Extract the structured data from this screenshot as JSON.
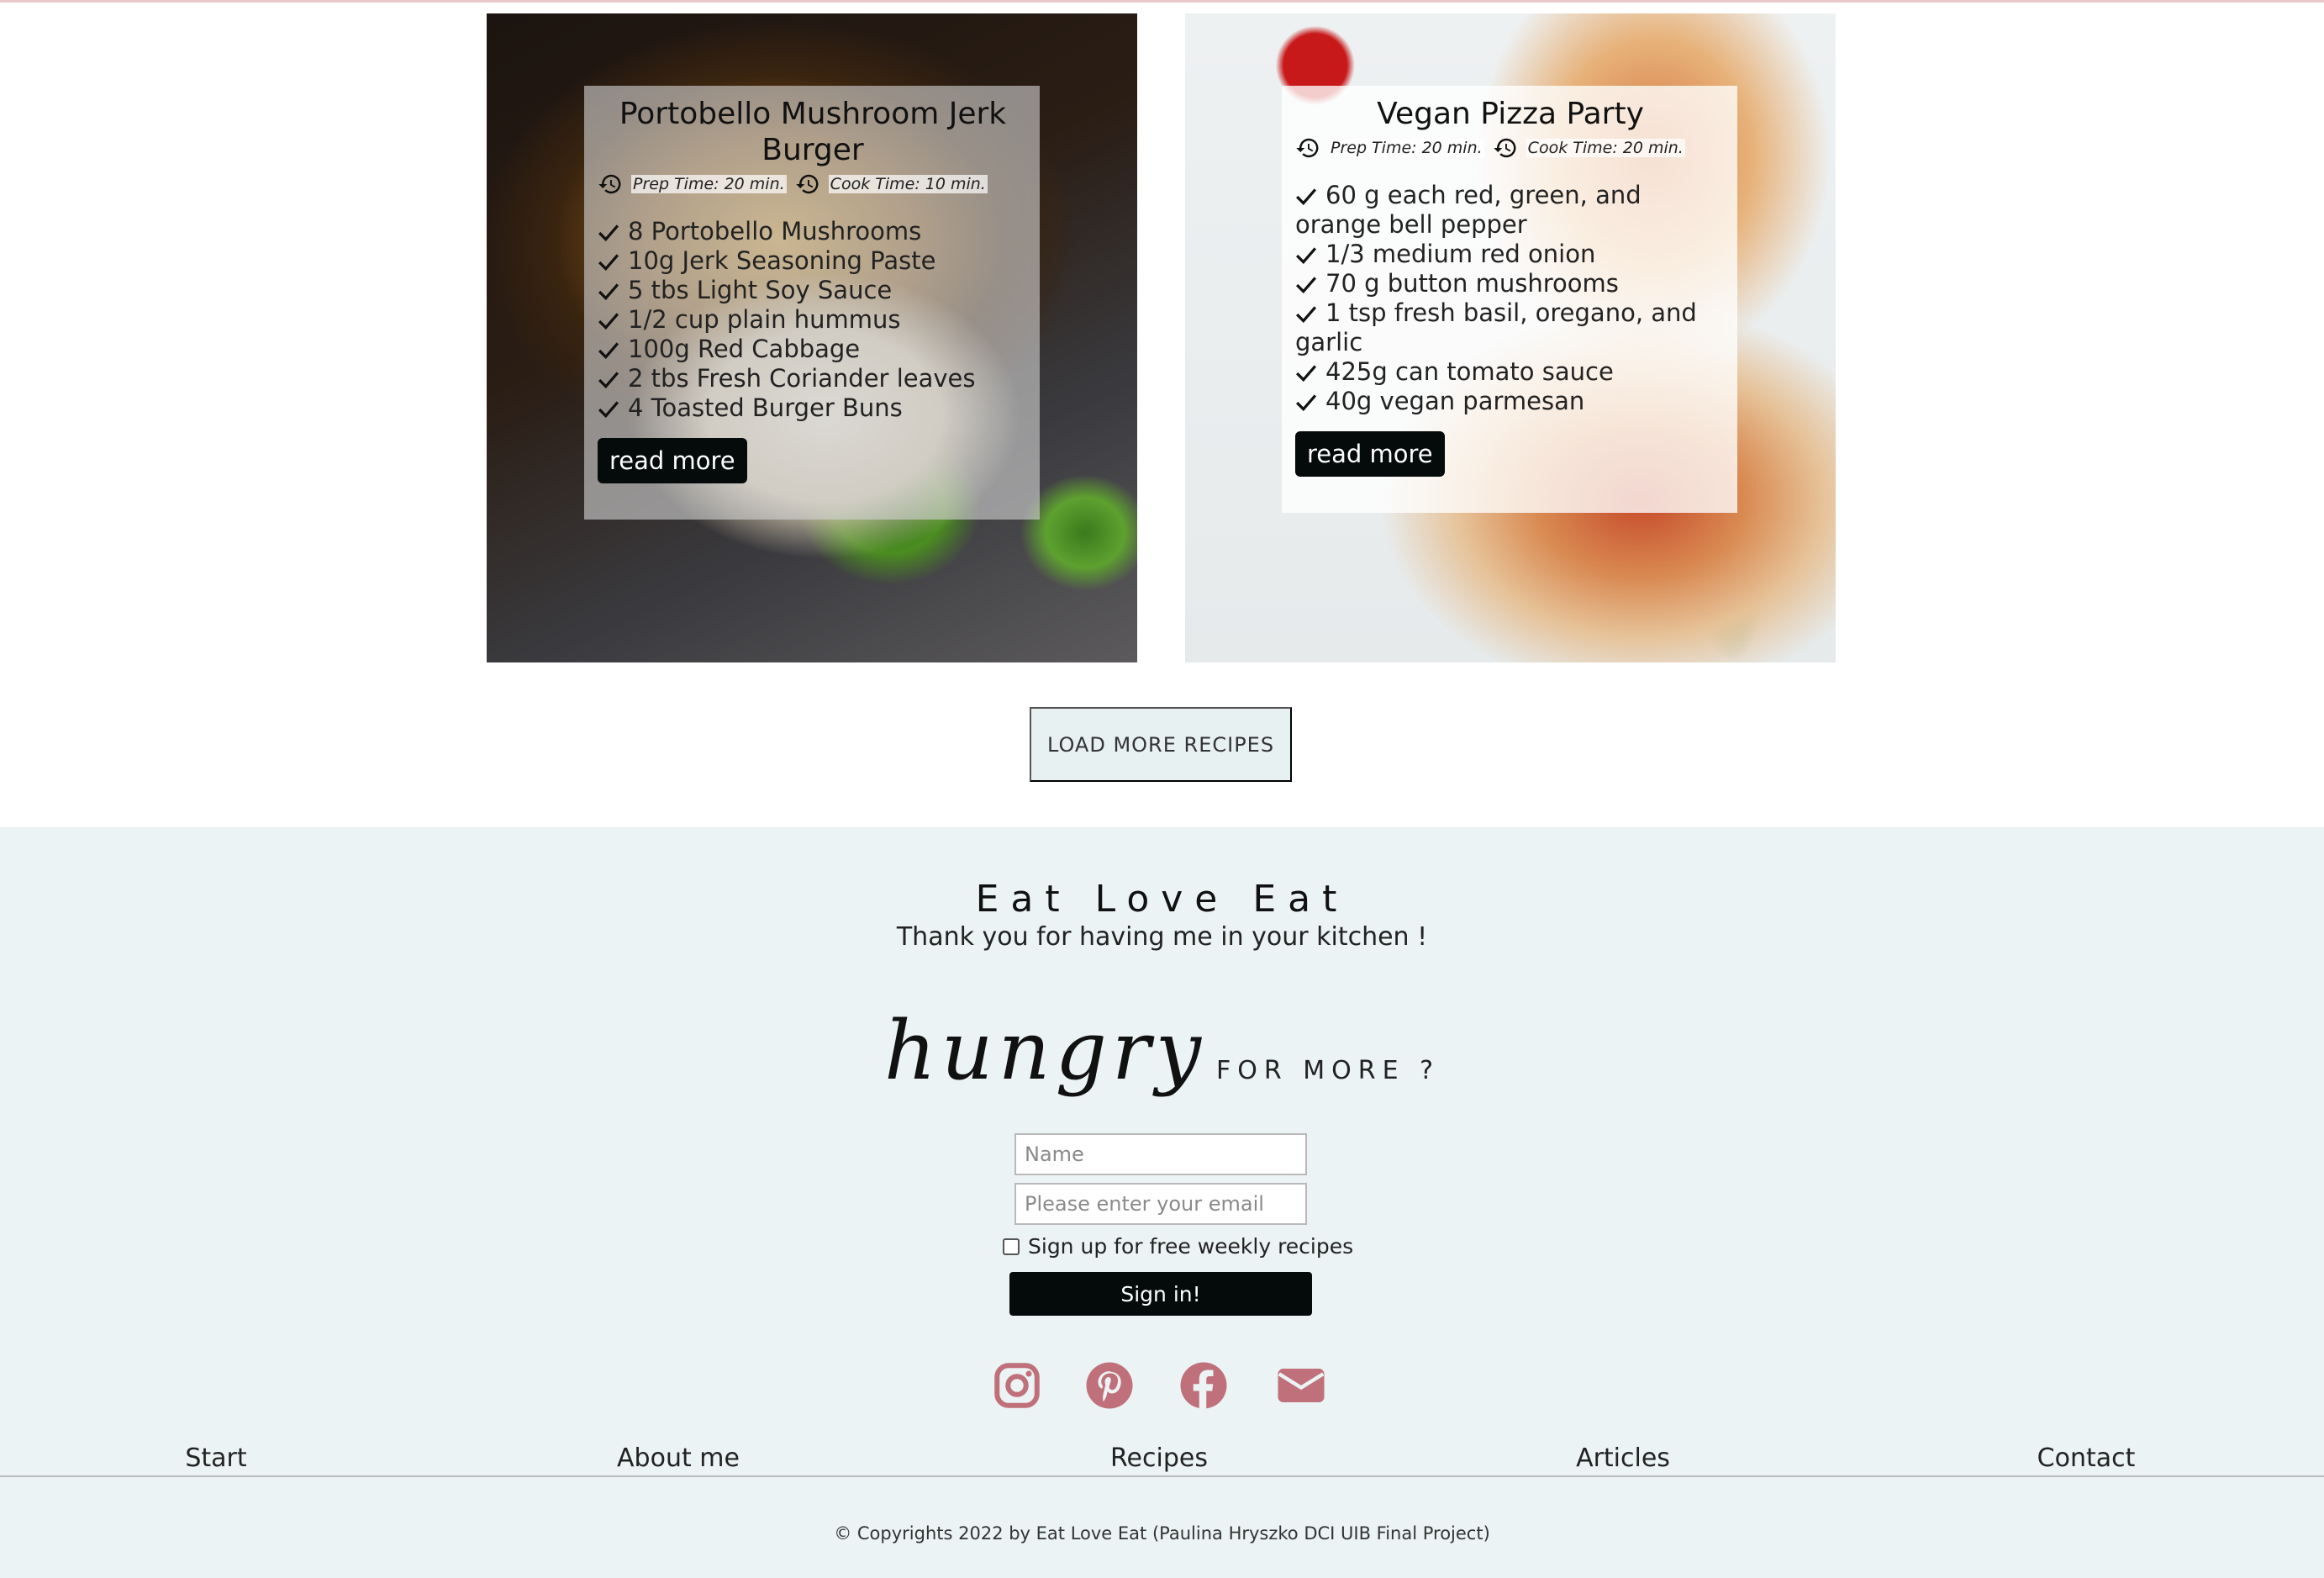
{
  "recipes": [
    {
      "title": "Portobello Mushroom Jerk Burger",
      "prep": "Prep Time: 20 min.",
      "cook": "Cook Time: 10 min.",
      "ingredients": [
        "8 Portobello Mushrooms",
        "10g Jerk Seasoning Paste",
        "5 tbs Light Soy Sauce",
        "1/2 cup plain hummus",
        "100g Red Cabbage",
        "2 tbs Fresh Coriander leaves",
        "4 Toasted Burger Buns"
      ],
      "button": "read more"
    },
    {
      "title": "Vegan Pizza Party",
      "prep": "Prep Time: 20 min.",
      "cook": "Cook Time: 20 min.",
      "ingredients": [
        "60 g each red, green, and orange bell pepper",
        "1/3 medium red onion",
        "70 g button mushrooms",
        "1 tsp fresh basil, oregano, and garlic",
        "425g can tomato sauce",
        "40g vegan parmesan"
      ],
      "button": "read more"
    }
  ],
  "load_more": "LOAD MORE RECIPES",
  "footer": {
    "brand": "Eat Love Eat",
    "tagline": "Thank you for having me in your kitchen !",
    "hungry_script": "hungry",
    "hungry_more": "FOR MORE ?",
    "name_placeholder": "Name",
    "email_placeholder": "Please enter your email",
    "signup_label": "Sign up for free weekly recipes",
    "signin_button": "Sign in!",
    "social_icons": [
      "instagram-icon",
      "pinterest-icon",
      "facebook-icon",
      "envelope-icon"
    ],
    "social_color": "#c0707a",
    "nav": [
      "Start",
      "About me",
      "Recipes",
      "Articles",
      "Contact"
    ],
    "copyright": "© Copyrights 2022 by Eat Love Eat (Paulina Hryszko DCI UIB Final Project)"
  }
}
